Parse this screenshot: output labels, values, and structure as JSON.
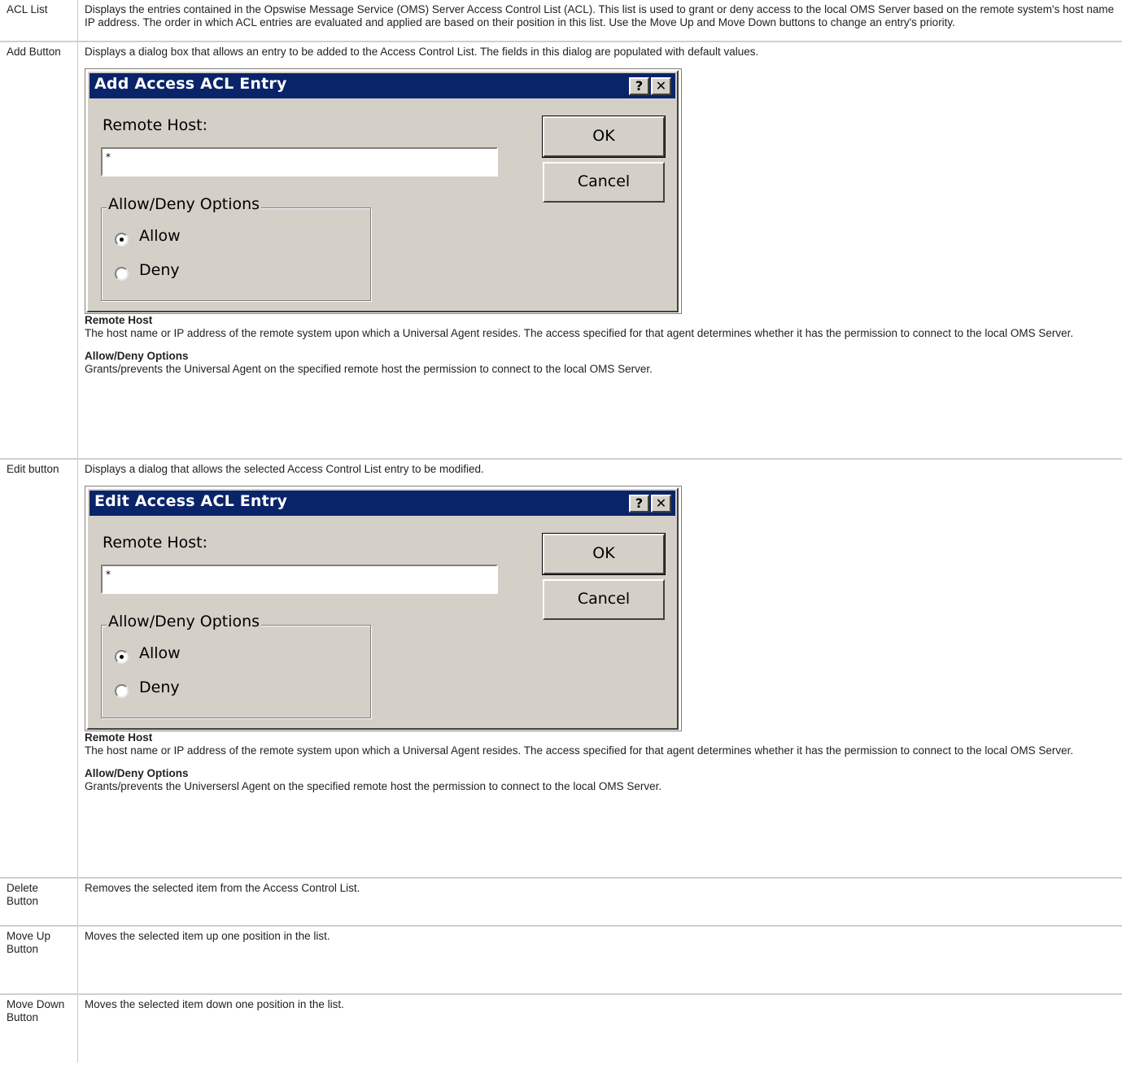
{
  "rows": {
    "acl": {
      "term": "ACL List",
      "desc": "Displays the entries contained in the Opswise Message Service (OMS) Server Access Control List (ACL). This list is used to grant or deny access to the local OMS Server based on the remote system's host name IP address. The order in which ACL entries are evaluated and applied are based on their position in this list. Use the Move Up and Move Down buttons to change an entry's priority."
    },
    "add": {
      "term": "Add Button",
      "desc": "Displays a dialog box that allows an entry to be added to the Access Control List. The fields in this dialog are populated with default values.",
      "dialog": {
        "title": "Add Access ACL Entry",
        "help_glyph": "?",
        "close_glyph": "✕",
        "remote_host_label": "Remote Host:",
        "remote_host_value": "*",
        "ok_label": "OK",
        "cancel_label": "Cancel",
        "group_label": "Allow/Deny Options",
        "allow_label": "Allow",
        "deny_label": "Deny",
        "selected": "Allow"
      },
      "field1_name": "Remote Host",
      "field1_desc": "The host name or IP address of the remote system upon which a Universal Agent resides. The access specified for that agent determines whether it has the permission to connect to the local OMS Server.",
      "field2_name": "Allow/Deny Options",
      "field2_desc": "Grants/prevents the Universal Agent on the specified remote host the permission to connect to the local OMS Server."
    },
    "edit": {
      "term": "Edit button",
      "desc": "Displays a dialog that allows the selected Access Control List entry to be modified.",
      "dialog": {
        "title": "Edit Access ACL Entry",
        "help_glyph": "?",
        "close_glyph": "✕",
        "remote_host_label": "Remote Host:",
        "remote_host_value": "*",
        "ok_label": "OK",
        "cancel_label": "Cancel",
        "group_label": "Allow/Deny Options",
        "allow_label": "Allow",
        "deny_label": "Deny",
        "selected": "Allow"
      },
      "field1_name": "Remote Host",
      "field1_desc": "The host name or IP address of the remote system upon which a Universal Agent resides. The access specified for that agent determines whether it has the permission to connect to the local OMS Server.",
      "field2_name": "Allow/Deny Options",
      "field2_desc": "Grants/prevents the Universersl Agent on the specified remote host the permission to connect to the local OMS Server."
    },
    "delete": {
      "term": "Delete Button",
      "desc": "Removes the selected item from the Access Control List."
    },
    "move_up": {
      "term": "Move Up Button",
      "desc": "Moves the selected item up one position in the list."
    },
    "move_down": {
      "term": "Move Down Button",
      "desc": "Moves the selected item down one position in the list."
    }
  },
  "colors": {
    "dialog_face": "#d4d0c8",
    "titlebar": "#0a246a",
    "row_separator": "#c9d0d8"
  }
}
